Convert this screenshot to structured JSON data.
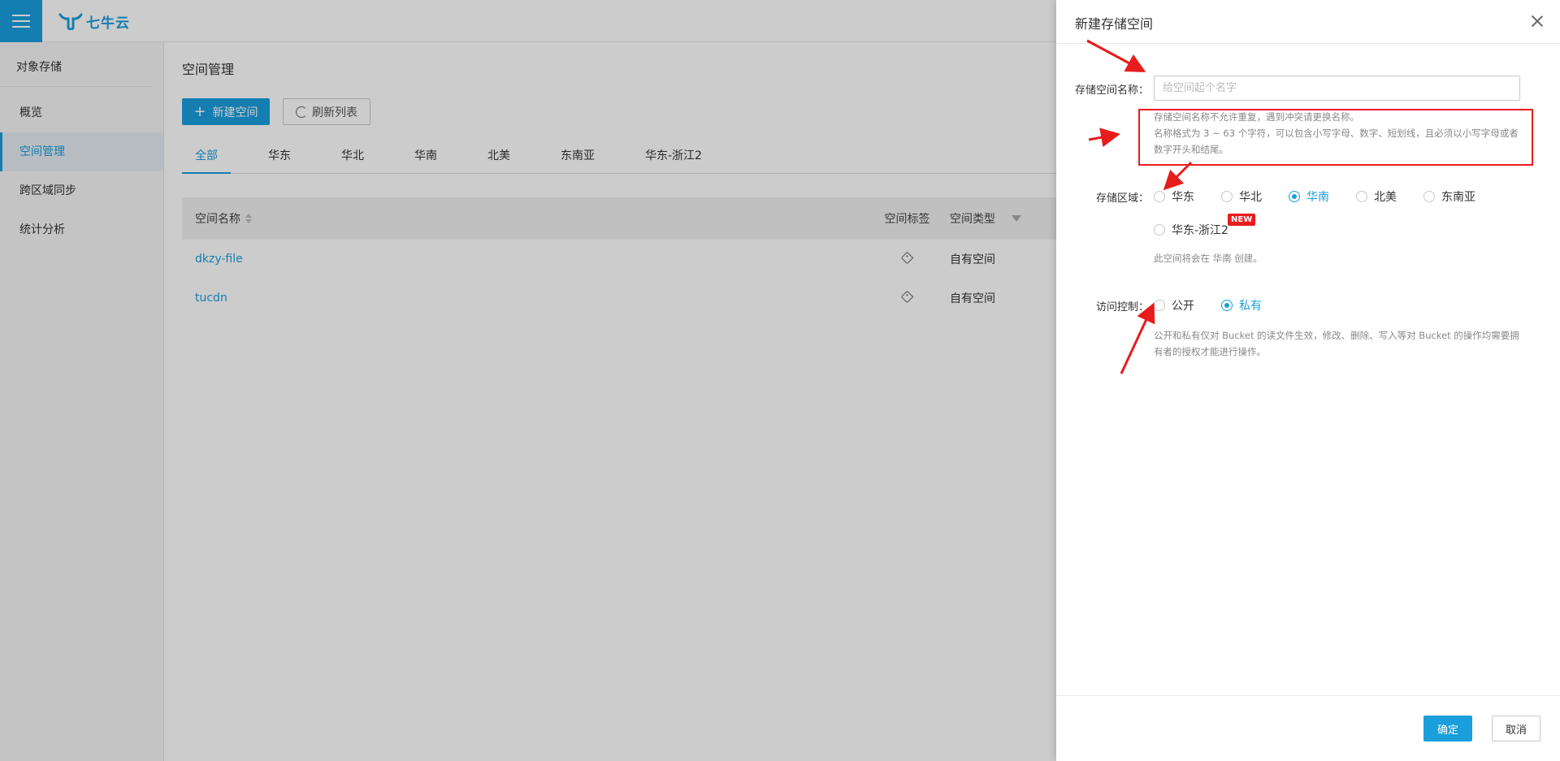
{
  "brand": {
    "logo_text": "七牛云",
    "accent_color": "#1a9edc"
  },
  "sidebar": {
    "title": "对象存储",
    "items": [
      {
        "label": "概览"
      },
      {
        "label": "空间管理"
      },
      {
        "label": "跨区域同步"
      },
      {
        "label": "统计分析"
      }
    ]
  },
  "main": {
    "page_title": "空间管理",
    "new_bucket_label": "新建空间",
    "refresh_label": "刷新列表",
    "region_tabs": [
      {
        "label": "全部"
      },
      {
        "label": "华东"
      },
      {
        "label": "华北"
      },
      {
        "label": "华南"
      },
      {
        "label": "北美"
      },
      {
        "label": "东南亚"
      },
      {
        "label": "华东-浙江2"
      }
    ],
    "table": {
      "headers": {
        "name": "空间名称",
        "tag": "空间标签",
        "type": "空间类型"
      },
      "rows": [
        {
          "name": "dkzy-file",
          "type": "自有空间"
        },
        {
          "name": "tucdn",
          "type": "自有空间"
        }
      ]
    }
  },
  "drawer": {
    "title": "新建存储空间",
    "name_label": "存储空间名称：",
    "name_placeholder": "给空间起个名字",
    "name_value": "",
    "name_hint_1": "存储空间名称不允许重复，遇到冲突请更换名称。",
    "name_hint_2": "名称格式为 3 ~ 63 个字符，可以包含小写字母、数字、短划线，且必须以小写字母或者数字开头和结尾。",
    "region_label": "存储区域：",
    "regions": [
      {
        "label": "华东"
      },
      {
        "label": "华北"
      },
      {
        "label": "华南"
      },
      {
        "label": "北美"
      },
      {
        "label": "东南亚"
      },
      {
        "label": "华东-浙江2"
      }
    ],
    "selected_region": "华南",
    "new_badge": "NEW",
    "region_hint": "此空间将会在 华南 创建。",
    "access_label": "访问控制：",
    "access_options": [
      {
        "label": "公开"
      },
      {
        "label": "私有"
      }
    ],
    "selected_access": "私有",
    "access_hint": "公开和私有仅对 Bucket 的读文件生效，修改、删除、写入等对 Bucket 的操作均需要拥有者的授权才能进行操作。",
    "ok_label": "确定",
    "cancel_label": "取消",
    "highlight_color": "#ee1c1c"
  }
}
